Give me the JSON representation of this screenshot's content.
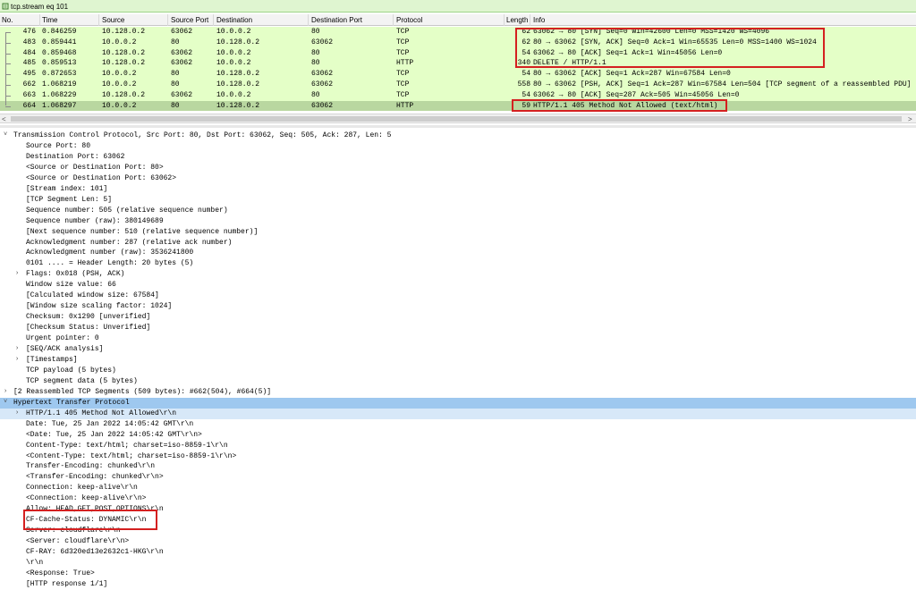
{
  "filter": {
    "value": "tcp.stream eq 101"
  },
  "columns": [
    "No.",
    "Time",
    "Source",
    "Source Port",
    "Destination",
    "Destination Port",
    "Protocol",
    "Length",
    "Info"
  ],
  "packets": [
    {
      "no": "476",
      "time": "0.846259",
      "src": "10.128.0.2",
      "sport": "63062",
      "dst": "10.0.0.2",
      "dport": "80",
      "proto": "TCP",
      "len": "62",
      "info": "63062 → 80 [SYN] Seq=0 Win=42600 Len=0 MSS=1420 WS=4096"
    },
    {
      "no": "483",
      "time": "0.859441",
      "src": "10.0.0.2",
      "sport": "80",
      "dst": "10.128.0.2",
      "dport": "63062",
      "proto": "TCP",
      "len": "62",
      "info": "80 → 63062 [SYN, ACK] Seq=0 Ack=1 Win=65535 Len=0 MSS=1400 WS=1024"
    },
    {
      "no": "484",
      "time": "0.859468",
      "src": "10.128.0.2",
      "sport": "63062",
      "dst": "10.0.0.2",
      "dport": "80",
      "proto": "TCP",
      "len": "54",
      "info": "63062 → 80 [ACK] Seq=1 Ack=1 Win=45056 Len=0"
    },
    {
      "no": "485",
      "time": "0.859513",
      "src": "10.128.0.2",
      "sport": "63062",
      "dst": "10.0.0.2",
      "dport": "80",
      "proto": "HTTP",
      "len": "340",
      "info": "DELETE / HTTP/1.1"
    },
    {
      "no": "495",
      "time": "0.872653",
      "src": "10.0.0.2",
      "sport": "80",
      "dst": "10.128.0.2",
      "dport": "63062",
      "proto": "TCP",
      "len": "54",
      "info": "80 → 63062 [ACK] Seq=1 Ack=287 Win=67584 Len=0"
    },
    {
      "no": "662",
      "time": "1.068219",
      "src": "10.0.0.2",
      "sport": "80",
      "dst": "10.128.0.2",
      "dport": "63062",
      "proto": "TCP",
      "len": "558",
      "info": "80 → 63062 [PSH, ACK] Seq=1 Ack=287 Win=67584 Len=504 [TCP segment of a reassembled PDU]"
    },
    {
      "no": "663",
      "time": "1.068229",
      "src": "10.128.0.2",
      "sport": "63062",
      "dst": "10.0.0.2",
      "dport": "80",
      "proto": "TCP",
      "len": "54",
      "info": "63062 → 80 [ACK] Seq=287 Ack=505 Win=45056 Len=0"
    },
    {
      "no": "664",
      "time": "1.068297",
      "src": "10.0.0.2",
      "sport": "80",
      "dst": "10.128.0.2",
      "dport": "63062",
      "proto": "HTTP",
      "len": "59",
      "info": "HTTP/1.1 405 Method Not Allowed  (text/html)"
    }
  ],
  "details": [
    {
      "indent": 0,
      "exp": "v",
      "text": "Transmission Control Protocol, Src Port: 80, Dst Port: 63062, Seq: 505, Ack: 287, Len: 5"
    },
    {
      "indent": 2,
      "exp": "",
      "text": "Source Port: 80"
    },
    {
      "indent": 2,
      "exp": "",
      "text": "Destination Port: 63062"
    },
    {
      "indent": 2,
      "exp": "",
      "text": "<Source or Destination Port: 80>"
    },
    {
      "indent": 2,
      "exp": "",
      "text": "<Source or Destination Port: 63062>"
    },
    {
      "indent": 2,
      "exp": "",
      "text": "[Stream index: 101]"
    },
    {
      "indent": 2,
      "exp": "",
      "text": "[TCP Segment Len: 5]"
    },
    {
      "indent": 2,
      "exp": "",
      "text": "Sequence number: 505    (relative sequence number)"
    },
    {
      "indent": 2,
      "exp": "",
      "text": "Sequence number (raw): 380149689"
    },
    {
      "indent": 2,
      "exp": "",
      "text": "[Next sequence number: 510    (relative sequence number)]"
    },
    {
      "indent": 2,
      "exp": "",
      "text": "Acknowledgment number: 287    (relative ack number)"
    },
    {
      "indent": 2,
      "exp": "",
      "text": "Acknowledgment number (raw): 3536241800"
    },
    {
      "indent": 2,
      "exp": "",
      "text": "0101 .... = Header Length: 20 bytes (5)"
    },
    {
      "indent": 1,
      "exp": ">",
      "text": "Flags: 0x018 (PSH, ACK)"
    },
    {
      "indent": 2,
      "exp": "",
      "text": "Window size value: 66"
    },
    {
      "indent": 2,
      "exp": "",
      "text": "[Calculated window size: 67584]"
    },
    {
      "indent": 2,
      "exp": "",
      "text": "[Window size scaling factor: 1024]"
    },
    {
      "indent": 2,
      "exp": "",
      "text": "Checksum: 0x1290 [unverified]"
    },
    {
      "indent": 2,
      "exp": "",
      "text": "[Checksum Status: Unverified]"
    },
    {
      "indent": 2,
      "exp": "",
      "text": "Urgent pointer: 0"
    },
    {
      "indent": 1,
      "exp": ">",
      "text": "[SEQ/ACK analysis]"
    },
    {
      "indent": 1,
      "exp": ">",
      "text": "[Timestamps]"
    },
    {
      "indent": 2,
      "exp": "",
      "text": "TCP payload (5 bytes)"
    },
    {
      "indent": 2,
      "exp": "",
      "text": "TCP segment data (5 bytes)"
    },
    {
      "indent": 0,
      "exp": ">",
      "text": "[2 Reassembled TCP Segments (509 bytes): #662(504), #664(5)]"
    },
    {
      "indent": 0,
      "exp": "v",
      "text": "Hypertext Transfer Protocol",
      "sel": true
    },
    {
      "indent": 1,
      "exp": ">",
      "text": "HTTP/1.1 405 Method Not Allowed\\r\\n",
      "sel2": true
    },
    {
      "indent": 2,
      "exp": "",
      "text": "Date: Tue, 25 Jan 2022 14:05:42 GMT\\r\\n"
    },
    {
      "indent": 2,
      "exp": "",
      "text": "<Date: Tue, 25 Jan 2022 14:05:42 GMT\\r\\n>"
    },
    {
      "indent": 2,
      "exp": "",
      "text": "Content-Type: text/html; charset=iso-8859-1\\r\\n"
    },
    {
      "indent": 2,
      "exp": "",
      "text": "<Content-Type: text/html; charset=iso-8859-1\\r\\n>"
    },
    {
      "indent": 2,
      "exp": "",
      "text": "Transfer-Encoding: chunked\\r\\n"
    },
    {
      "indent": 2,
      "exp": "",
      "text": "<Transfer-Encoding: chunked\\r\\n>"
    },
    {
      "indent": 2,
      "exp": "",
      "text": "Connection: keep-alive\\r\\n"
    },
    {
      "indent": 2,
      "exp": "",
      "text": "<Connection: keep-alive\\r\\n>"
    },
    {
      "indent": 2,
      "exp": "",
      "text": "Allow: HEAD,GET,POST,OPTIONS\\r\\n"
    },
    {
      "indent": 2,
      "exp": "",
      "text": "CF-Cache-Status: DYNAMIC\\r\\n"
    },
    {
      "indent": 2,
      "exp": "",
      "text": "Server: cloudflare\\r\\n"
    },
    {
      "indent": 2,
      "exp": "",
      "text": "<Server: cloudflare\\r\\n>"
    },
    {
      "indent": 2,
      "exp": "",
      "text": "CF-RAY: 6d320ed13e2632c1-HKG\\r\\n"
    },
    {
      "indent": 2,
      "exp": "",
      "text": "\\r\\n"
    },
    {
      "indent": 2,
      "exp": "",
      "text": "<Response: True>"
    },
    {
      "indent": 2,
      "exp": "",
      "text": "[HTTP response 1/1]"
    }
  ],
  "colors": {
    "row_bg": "#e4ffc7",
    "row_selected": "#b9d7a0",
    "detail_selected": "#9ec8ef",
    "highlight_box": "#d42020"
  }
}
